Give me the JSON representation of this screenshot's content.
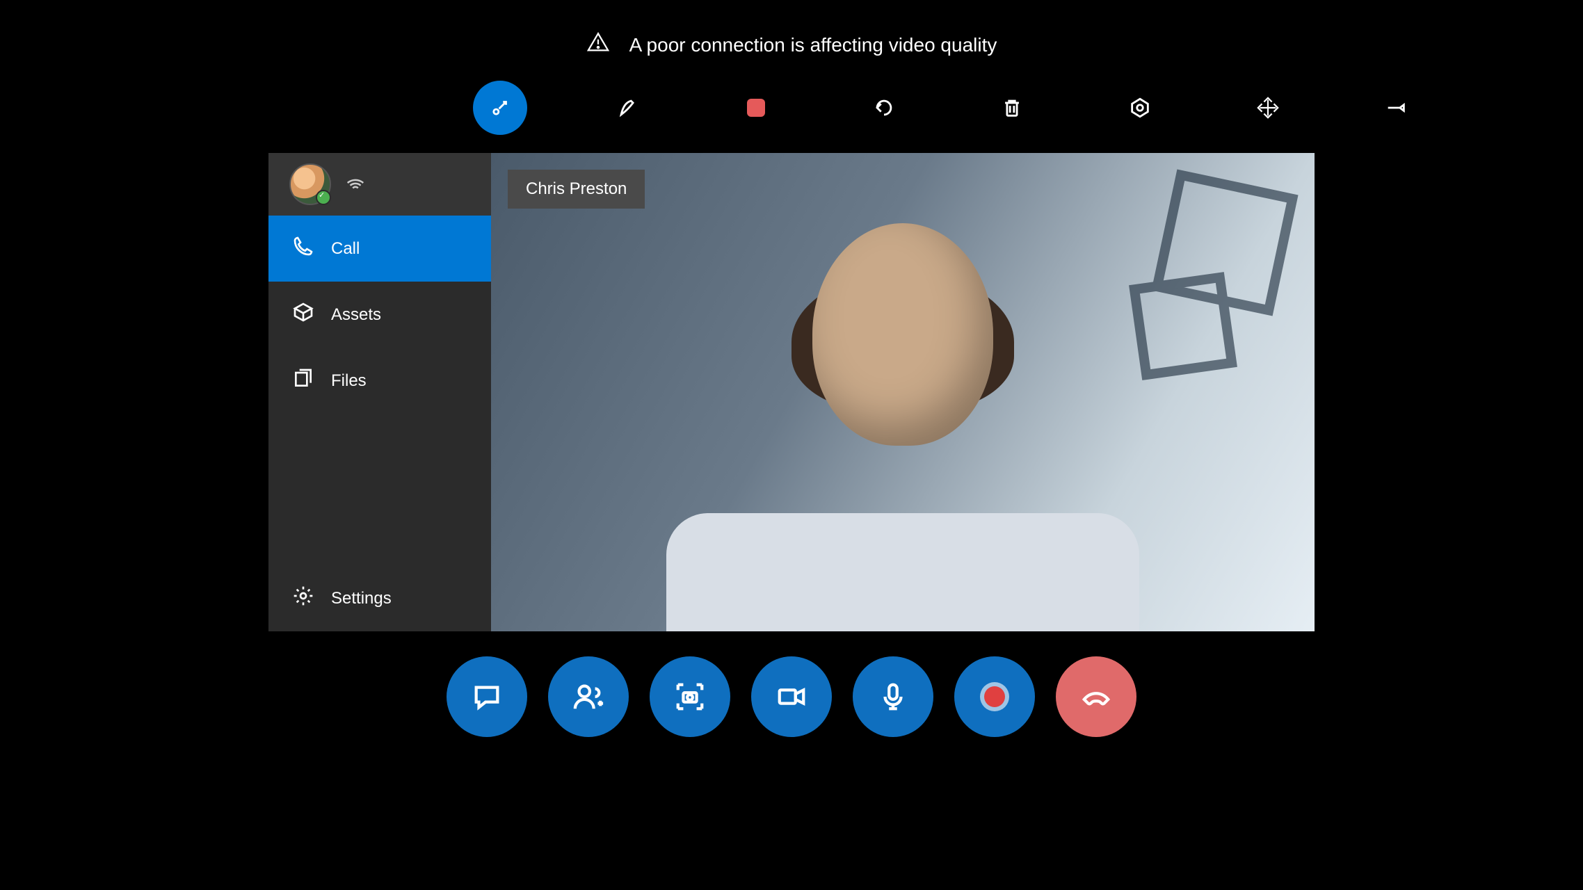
{
  "warning": {
    "text": "A poor connection is affecting video quality"
  },
  "toolbar": {
    "items": [
      {
        "name": "pointer",
        "active": true
      },
      {
        "name": "draw",
        "active": false
      },
      {
        "name": "shape",
        "active": false
      },
      {
        "name": "undo",
        "active": false
      },
      {
        "name": "delete",
        "active": false
      },
      {
        "name": "track",
        "active": false
      },
      {
        "name": "expand",
        "active": false
      },
      {
        "name": "pin",
        "active": false
      }
    ]
  },
  "sidebar": {
    "items": [
      {
        "label": "Call",
        "icon": "phone",
        "active": true
      },
      {
        "label": "Assets",
        "icon": "box",
        "active": false
      },
      {
        "label": "Files",
        "icon": "files",
        "active": false
      },
      {
        "label": "Settings",
        "icon": "gear",
        "active": false
      }
    ]
  },
  "video": {
    "caller_name": "Chris Preston"
  },
  "controls": {
    "buttons": [
      {
        "name": "chat",
        "icon": "chat"
      },
      {
        "name": "add-people",
        "icon": "people"
      },
      {
        "name": "snapshot",
        "icon": "camera"
      },
      {
        "name": "video",
        "icon": "video"
      },
      {
        "name": "mic",
        "icon": "mic"
      },
      {
        "name": "record",
        "icon": "record"
      },
      {
        "name": "end-call",
        "icon": "hangup",
        "end": true
      }
    ]
  }
}
